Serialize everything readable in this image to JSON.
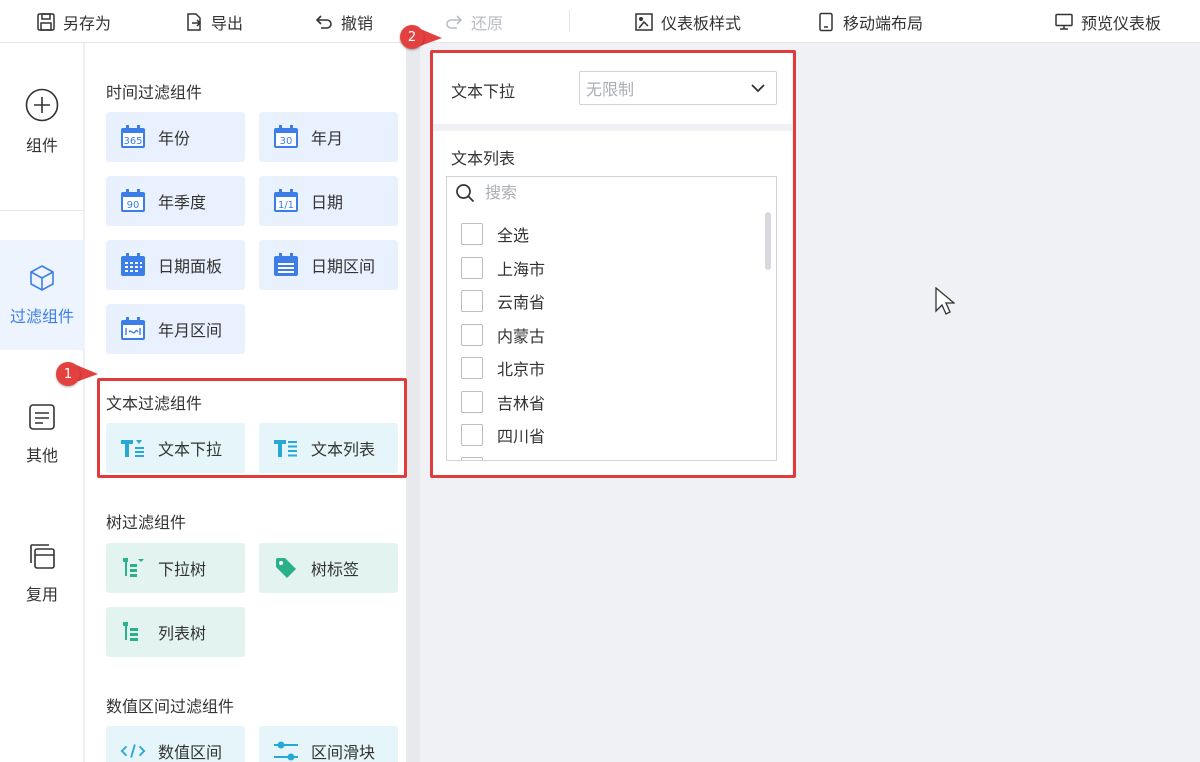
{
  "toolbar": {
    "save_as": "另存为",
    "export": "导出",
    "undo": "撤销",
    "redo": "还原",
    "dashboard_style": "仪表板样式",
    "mobile_layout": "移动端布局",
    "preview": "预览仪表板"
  },
  "leftnav": {
    "items": [
      {
        "label": "组件",
        "icon": "plus-circle-icon"
      },
      {
        "label": "过滤组件",
        "icon": "cube-icon",
        "active": true
      },
      {
        "label": "其他",
        "icon": "note-icon"
      },
      {
        "label": "复用",
        "icon": "copy-icon"
      }
    ]
  },
  "panel": {
    "time_section": "时间过滤组件",
    "time_items": [
      "年份",
      "年月",
      "年季度",
      "日期",
      "日期面板",
      "日期区间",
      "年月区间"
    ],
    "time_icon_labels": [
      "365",
      "30",
      "90",
      "1/1"
    ],
    "text_section": "文本过滤组件",
    "text_items": [
      "文本下拉",
      "文本列表"
    ],
    "tree_section": "树过滤组件",
    "tree_items": [
      "下拉树",
      "树标签",
      "列表树"
    ],
    "num_section": "数值区间过滤组件",
    "num_items": [
      "数值区间",
      "区间滑块"
    ]
  },
  "canvas": {
    "dropdown_widget": {
      "label": "文本下拉",
      "value": "无限制"
    },
    "list_widget": {
      "label": "文本列表",
      "search_placeholder": "搜索",
      "options": [
        "全选",
        "上海市",
        "云南省",
        "内蒙古",
        "北京市",
        "吉林省",
        "四川省"
      ]
    }
  },
  "annotations": {
    "badge1": "1",
    "badge2": "2"
  },
  "colors": {
    "accent": "#3c7ee8",
    "annotation": "#e03c3c",
    "chip_blue": "#e8f1fd",
    "chip_teal": "#e3f3ef"
  }
}
